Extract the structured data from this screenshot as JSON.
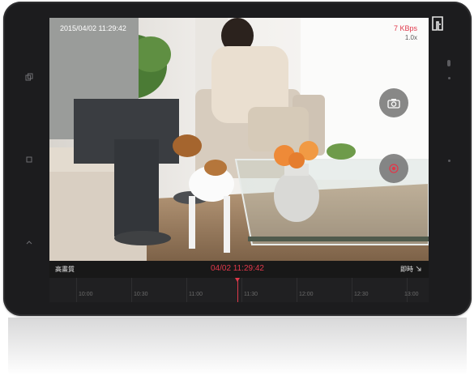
{
  "overlay": {
    "timestamp": "2015/04/02  11:29:42",
    "bitrate": "7 KBps",
    "speed": "1.0x"
  },
  "controls": {
    "quality_label": "高畫質",
    "current_time": "04/02  11:29:42",
    "live_label": "即時",
    "snapshot_icon": "camera-icon",
    "record_icon": "record-icon",
    "live_icon": "live-arrow-icon"
  },
  "timeline": {
    "labels": [
      "10:00",
      "10:30",
      "11:00",
      "11:30",
      "12:00",
      "12:30",
      "13:00"
    ],
    "playhead_time": "11:29:42"
  },
  "device": {
    "side_icons": [
      "copy-icon",
      "square-icon",
      "chevron-up-icon"
    ]
  },
  "colors": {
    "accent": "#e0384a",
    "frame": "#1c1c1e"
  }
}
